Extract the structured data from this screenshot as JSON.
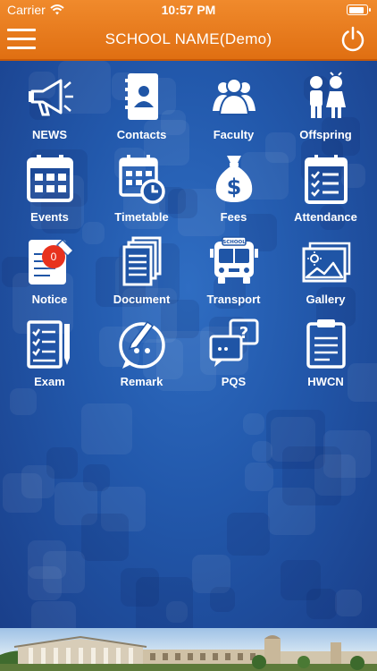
{
  "status": {
    "carrier": "Carrier",
    "time": "10:57 PM",
    "battery_level": 0.85
  },
  "header": {
    "title": "SCHOOL NAME(Demo)"
  },
  "menu": [
    {
      "label": "NEWS",
      "icon": "megaphone-icon"
    },
    {
      "label": "Contacts",
      "icon": "contact-book-icon"
    },
    {
      "label": "Faculty",
      "icon": "people-group-icon"
    },
    {
      "label": "Offspring",
      "icon": "children-icon"
    },
    {
      "label": "Events",
      "icon": "calendar-icon"
    },
    {
      "label": "Timetable",
      "icon": "calendar-clock-icon"
    },
    {
      "label": "Fees",
      "icon": "money-bag-icon"
    },
    {
      "label": "Attendance",
      "icon": "checklist-icon"
    },
    {
      "label": "Notice",
      "icon": "notice-icon",
      "badge": "0"
    },
    {
      "label": "Document",
      "icon": "documents-icon"
    },
    {
      "label": "Transport",
      "icon": "school-bus-icon"
    },
    {
      "label": "Gallery",
      "icon": "gallery-icon"
    },
    {
      "label": "Exam",
      "icon": "exam-sheet-icon"
    },
    {
      "label": "Remark",
      "icon": "remark-bubble-icon"
    },
    {
      "label": "PQS",
      "icon": "question-chat-icon"
    },
    {
      "label": "HWCN",
      "icon": "clipboard-icon"
    }
  ],
  "bus_sign": "SCHOOL",
  "colors": {
    "header": "#e9781c",
    "background": "#2258ab",
    "badge": "#e8321e"
  }
}
